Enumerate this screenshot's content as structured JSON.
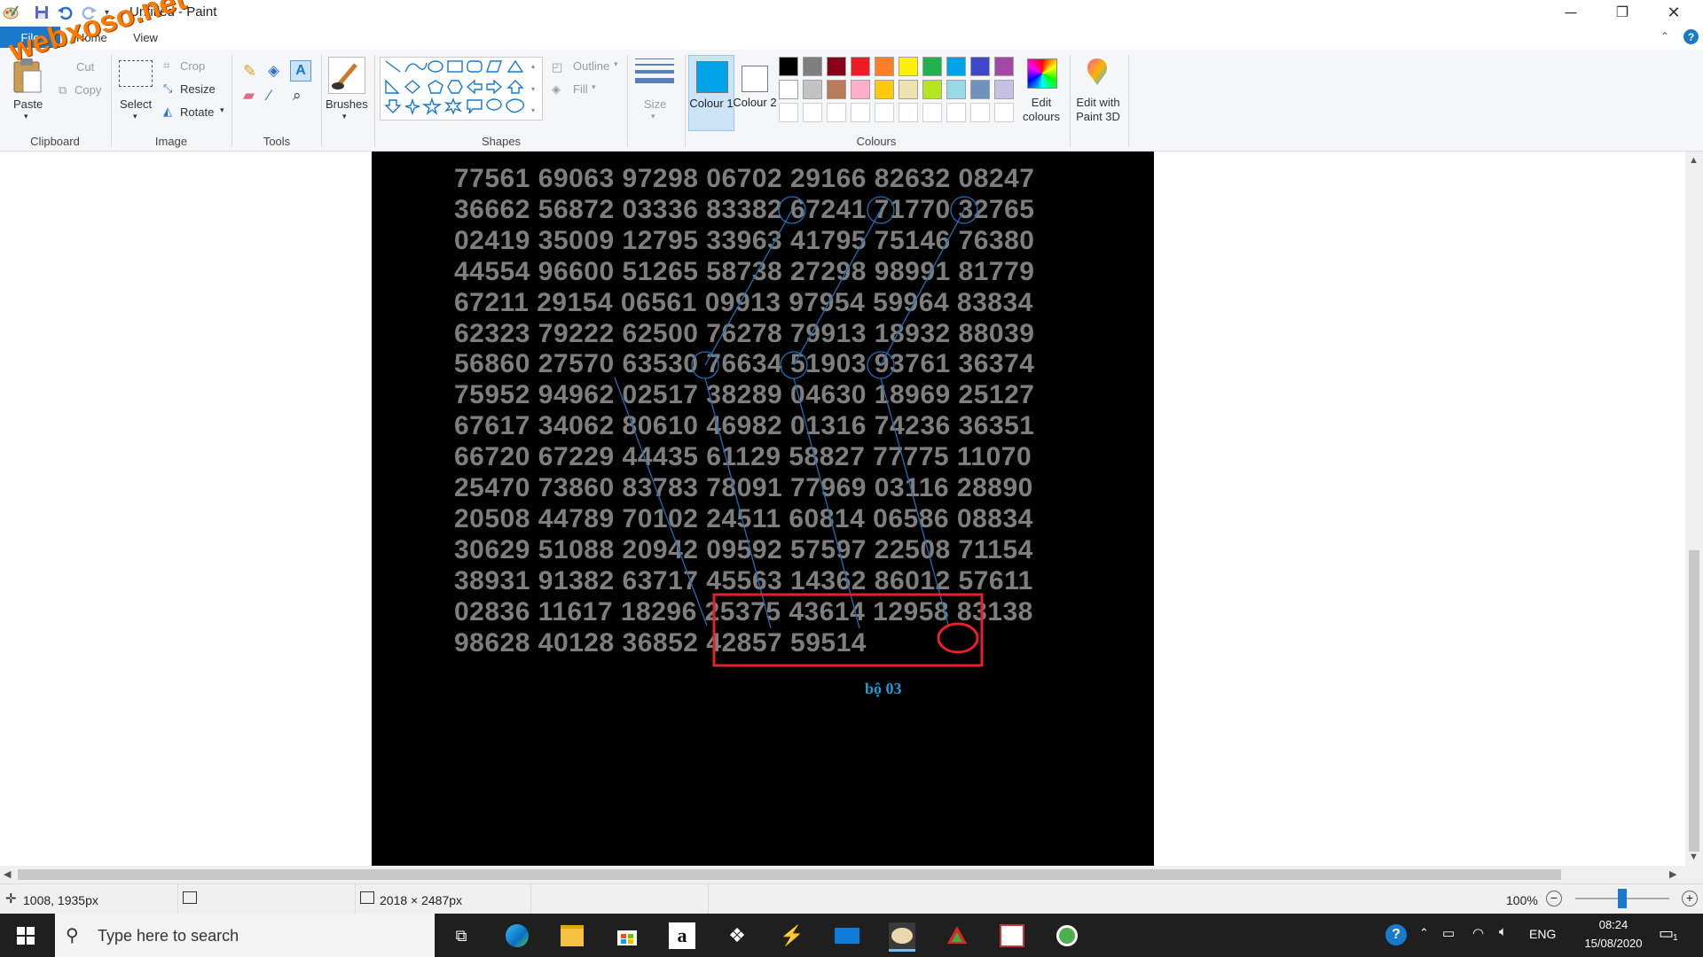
{
  "window": {
    "title": "Untitled - Paint",
    "minimize": "─",
    "restore": "❐",
    "close": "✕"
  },
  "watermark": "webxoso.net",
  "tabs": {
    "file": "File",
    "home": "Home",
    "view": "View"
  },
  "ribbon": {
    "clipboard": {
      "label": "Clipboard",
      "paste": "Paste",
      "cut": "Cut",
      "copy": "Copy"
    },
    "image": {
      "label": "Image",
      "select": "Select",
      "crop": "Crop",
      "resize": "Resize",
      "rotate": "Rotate"
    },
    "tools": {
      "label": "Tools"
    },
    "brushes": {
      "label": "Brushes"
    },
    "shapes": {
      "label": "Shapes",
      "outline": "Outline",
      "fill": "Fill"
    },
    "size": {
      "label": "Size"
    },
    "colours": {
      "label": "Colours",
      "colour1": "Colour 1",
      "colour2": "Colour 2",
      "edit_colours": "Edit colours",
      "edit_paint3d": "Edit with Paint 3D",
      "colour1_value": "#00a2e8",
      "colour2_value": "#ffffff",
      "palette_row1": [
        "#000000",
        "#7f7f7f",
        "#880015",
        "#ed1c24",
        "#ff7f27",
        "#fff200",
        "#22b14c",
        "#00a2e8",
        "#3f48cc",
        "#a349a4"
      ],
      "palette_row2": [
        "#ffffff",
        "#c3c3c3",
        "#b97a57",
        "#ffaec9",
        "#ffc90e",
        "#efe4b0",
        "#b5e61d",
        "#99d9ea",
        "#7092be",
        "#c8bfe7"
      ]
    }
  },
  "canvas": {
    "rows": [
      "77561 69063 97298 06702 29166 82632 08247",
      "36662 56872 03336 83382 67241 71770 32765",
      "02419 35009 12795 33963 41795 75146 76380",
      "44554 96600 51265 58738 27298 98991 81779",
      "67211 29154 06561 09913 97954 59964 83834",
      "62323 79222 62500 76278 79913 18932 88039",
      "56860 27570 63530 76634 51903 93761 36374",
      "75952 94962 02517 38289 04630 18969 25127",
      "67617 34062 80610 46982 01316 74236 36351",
      "66720 67229 44435 61129 58827 77775 11070",
      "25470 73860 83783 78091 77969 03116 28890",
      "20508 44789 70102 24511 60814 06586 08834",
      "30629 51088 20942 09592 57597 22508 71154",
      "38931 91382 63717 45563 14362 86012 57611",
      "02836 11617 18296 25375 43614 12958 83138",
      "98628 40128 36852 42857 59514"
    ],
    "annotation": "bộ 03"
  },
  "status": {
    "cursor": "1008, 1935px",
    "dimensions": "2018 × 2487px",
    "zoom": "100%",
    "zoom_fraction": 0.5
  },
  "taskbar": {
    "search_placeholder": "Type here to search",
    "language": "ENG",
    "time": "08:24",
    "date": "15/08/2020",
    "notifications": "1"
  }
}
